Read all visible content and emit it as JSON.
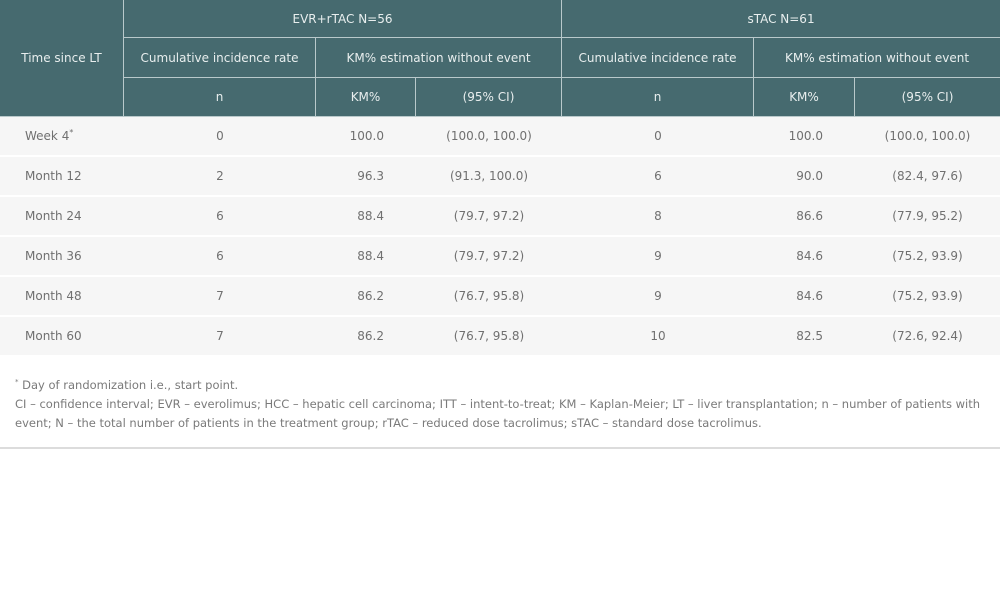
{
  "table": {
    "row_header_label": "Time since LT",
    "groups": [
      {
        "label": "EVR+rTAC N=56",
        "subheaders": [
          "Cumulative incidence rate",
          "KM% estimation without event"
        ],
        "columns": [
          "n",
          "KM%",
          "(95% CI)"
        ]
      },
      {
        "label": "sTAC N=61",
        "subheaders": [
          "Cumulative incidence rate",
          "KM% estimation without event"
        ],
        "columns": [
          "n",
          "KM%",
          "(95% CI)"
        ]
      }
    ],
    "rows": [
      {
        "time": "Week 4",
        "marker": "*",
        "evr_n": "0",
        "evr_km": "100.0",
        "evr_ci": "(100.0, 100.0)",
        "stac_n": "0",
        "stac_km": "100.0",
        "stac_ci": "(100.0, 100.0)"
      },
      {
        "time": "Month 12",
        "marker": "",
        "evr_n": "2",
        "evr_km": "96.3",
        "evr_ci": "(91.3, 100.0)",
        "stac_n": "6",
        "stac_km": "90.0",
        "stac_ci": "(82.4, 97.6)"
      },
      {
        "time": "Month 24",
        "marker": "",
        "evr_n": "6",
        "evr_km": "88.4",
        "evr_ci": "(79.7, 97.2)",
        "stac_n": "8",
        "stac_km": "86.6",
        "stac_ci": "(77.9, 95.2)"
      },
      {
        "time": "Month 36",
        "marker": "",
        "evr_n": "6",
        "evr_km": "88.4",
        "evr_ci": "(79.7, 97.2)",
        "stac_n": "9",
        "stac_km": "84.6",
        "stac_ci": "(75.2, 93.9)"
      },
      {
        "time": "Month 48",
        "marker": "",
        "evr_n": "7",
        "evr_km": "86.2",
        "evr_ci": "(76.7, 95.8)",
        "stac_n": "9",
        "stac_km": "84.6",
        "stac_ci": "(75.2, 93.9)"
      },
      {
        "time": "Month 60",
        "marker": "",
        "evr_n": "7",
        "evr_km": "86.2",
        "evr_ci": "(76.7, 95.8)",
        "stac_n": "10",
        "stac_km": "82.5",
        "stac_ci": "(72.6, 92.4)"
      }
    ]
  },
  "notes": {
    "footnote_marker": "*",
    "footnote_text": " Day of randomization i.e., start point.",
    "abbreviations": "CI – confidence interval; EVR – everolimus; HCC – hepatic cell carcinoma; ITT – intent-to-treat; KM – Kaplan-Meier; LT – liver transplantation; n – number of patients with event; N – the total number of patients in the treatment group; rTAC – reduced dose tacrolimus; sTAC – standard dose tacrolimus."
  },
  "colors": {
    "header_bg": "#466a6f",
    "header_text": "#e8eeee",
    "row_bg": "#f6f6f6",
    "body_text": "#707070"
  }
}
